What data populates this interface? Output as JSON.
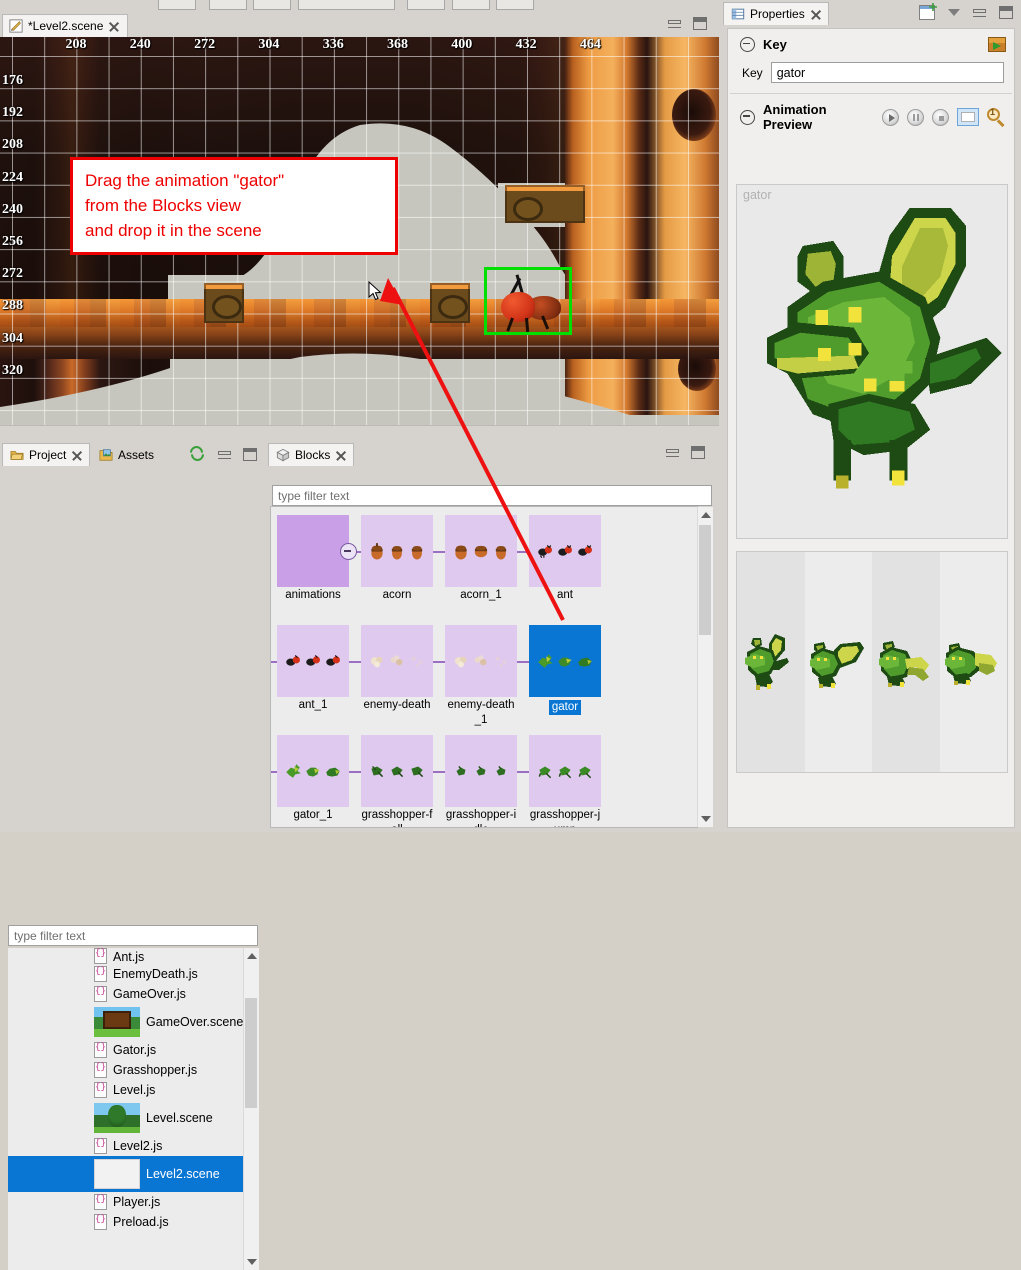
{
  "window": {
    "toolbar_buttons": [
      "",
      "",
      "",
      "",
      "",
      "",
      ""
    ]
  },
  "scene_editor": {
    "tab": {
      "title": "*Level2.scene",
      "icon": "scene-file-icon",
      "close": "close-icon"
    },
    "controls": {
      "minimize": "minimize-icon",
      "maximize": "maximize-icon"
    },
    "ruler_top": [
      "208",
      "240",
      "272",
      "304",
      "336",
      "368",
      "400",
      "432",
      "464"
    ],
    "ruler_left": [
      "176",
      "192",
      "208",
      "224",
      "240",
      "256",
      "272",
      "288",
      "304",
      "320"
    ],
    "callout": {
      "line1": "Drag the animation \"gator\"",
      "line2": "from the Blocks view",
      "line3": "and drop it in the scene",
      "border_color": "#ee0000",
      "text_color": "#ee0000"
    },
    "selection_color": "#00e000",
    "cursor": "arrow-cursor",
    "drag_arrow_color": "#ee1111"
  },
  "project_view": {
    "tabs": [
      {
        "label": "Project",
        "icon": "folder-open-icon",
        "active": true,
        "closeable": true
      },
      {
        "label": "Assets",
        "icon": "assets-folder-icon",
        "active": false,
        "closeable": false
      }
    ],
    "toolbar": {
      "refresh": "refresh-icon",
      "minimize": "minimize-icon",
      "maximize": "maximize-icon"
    },
    "filter_placeholder": "type filter text",
    "items": [
      {
        "label": "Ant.js",
        "kind": "js",
        "selected": false,
        "clipped": true
      },
      {
        "label": "EnemyDeath.js",
        "kind": "js",
        "selected": false
      },
      {
        "label": "GameOver.js",
        "kind": "js",
        "selected": false
      },
      {
        "label": "GameOver.scene",
        "kind": "scene-gameover",
        "selected": false
      },
      {
        "label": "Gator.js",
        "kind": "js",
        "selected": false
      },
      {
        "label": "Grasshopper.js",
        "kind": "js",
        "selected": false
      },
      {
        "label": "Level.js",
        "kind": "js",
        "selected": false
      },
      {
        "label": "Level.scene",
        "kind": "scene-level",
        "selected": false
      },
      {
        "label": "Level2.js",
        "kind": "js",
        "selected": false
      },
      {
        "label": "Level2.scene",
        "kind": "scene-blank",
        "selected": true
      },
      {
        "label": "Player.js",
        "kind": "js",
        "selected": false
      },
      {
        "label": "Preload.js",
        "kind": "js",
        "selected": false
      }
    ]
  },
  "blocks_view": {
    "tab": {
      "label": "Blocks",
      "icon": "blocks-icon",
      "close": "close-icon"
    },
    "controls": {
      "minimize": "minimize-icon",
      "maximize": "maximize-icon"
    },
    "filter_placeholder": "type filter text",
    "blocks": [
      {
        "label": "animations",
        "type": "folder",
        "selected": false
      },
      {
        "label": "acorn",
        "type": "animation",
        "sprite": "acorn",
        "selected": false
      },
      {
        "label": "acorn_1",
        "type": "animation",
        "sprite": "acorn",
        "selected": false
      },
      {
        "label": "ant",
        "type": "animation",
        "sprite": "ant",
        "selected": false
      },
      {
        "label": "ant_1",
        "type": "animation",
        "sprite": "ant",
        "selected": false
      },
      {
        "label": "enemy-death",
        "type": "animation",
        "sprite": "puff",
        "selected": false
      },
      {
        "label": "enemy-death_1",
        "type": "animation",
        "sprite": "puff",
        "selected": false
      },
      {
        "label": "gator",
        "type": "animation",
        "sprite": "gator",
        "selected": true
      },
      {
        "label": "gator_1",
        "type": "animation",
        "sprite": "gator",
        "selected": false
      },
      {
        "label": "grasshopper-fall",
        "type": "animation",
        "sprite": "grasshopper",
        "selected": false
      },
      {
        "label": "grasshopper-idle",
        "type": "animation",
        "sprite": "grasshopper",
        "selected": false
      },
      {
        "label": "grasshopper-jump",
        "type": "animation",
        "sprite": "grasshopper",
        "selected": false
      }
    ]
  },
  "properties_view": {
    "tab": {
      "label": "Properties",
      "icon": "properties-table-icon",
      "close": "close-icon"
    },
    "toolbar": {
      "new": "new-properties-view-icon",
      "menu": "view-menu-chevron-icon",
      "minimize": "minimize-icon",
      "maximize": "maximize-icon"
    },
    "sections": [
      {
        "title": "Key",
        "collapse": "collapse-icon",
        "action_icon": "export-icon",
        "field_label": "Key",
        "field_value": "gator"
      },
      {
        "title": "Animation Preview",
        "collapse": "collapse-icon",
        "buttons": [
          "play-icon",
          "pause-icon",
          "stop-icon",
          "show-frames-toggle-icon",
          "zoom-one-to-one-icon"
        ],
        "preview_placeholder": "gator",
        "frame_count": 4
      }
    ]
  },
  "colors": {
    "selection_blue": "#0a76d4",
    "block_lilac": "#e0c9ef",
    "folder_purple": "#c9a0e8",
    "panel_grey": "#d6d2ce",
    "scene_grey": "#c8c8c0",
    "accent_red": "#ee0000",
    "selection_green": "#00e000"
  }
}
